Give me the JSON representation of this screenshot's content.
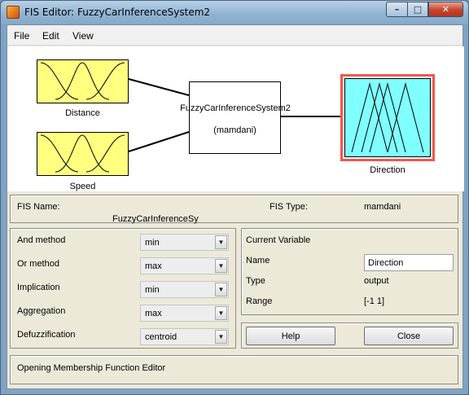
{
  "window": {
    "title": "FIS Editor: FuzzyCarInferenceSystem2"
  },
  "menu": {
    "items": [
      "File",
      "Edit",
      "View"
    ]
  },
  "diagram": {
    "inputs": [
      {
        "label": "Distance",
        "color": "#ffff80"
      },
      {
        "label": "Speed",
        "color": "#ffff80"
      }
    ],
    "system": {
      "name": "FuzzyCarInferenceSystem2",
      "type_label": "(mamdani)"
    },
    "output": {
      "label": "Direction",
      "color": "#80ffff",
      "selected_border": "#f2564c"
    }
  },
  "fis_info": {
    "name_label": "FIS Name:",
    "name_value": "FuzzyCarInferenceSy",
    "type_label": "FIS Type:",
    "type_value": "mamdani"
  },
  "methods": [
    {
      "label": "And method",
      "value": "min"
    },
    {
      "label": "Or method",
      "value": "max"
    },
    {
      "label": "Implication",
      "value": "min"
    },
    {
      "label": "Aggregation",
      "value": "max"
    },
    {
      "label": "Defuzzification",
      "value": "centroid"
    }
  ],
  "current_variable": {
    "title": "Current Variable",
    "name_label": "Name",
    "name_value": "Direction",
    "type_label": "Type",
    "type_value": "output",
    "range_label": "Range",
    "range_value": "[-1 1]"
  },
  "buttons": {
    "help": "Help",
    "close": "Close"
  },
  "status": {
    "text": "Opening Membership Function Editor"
  }
}
